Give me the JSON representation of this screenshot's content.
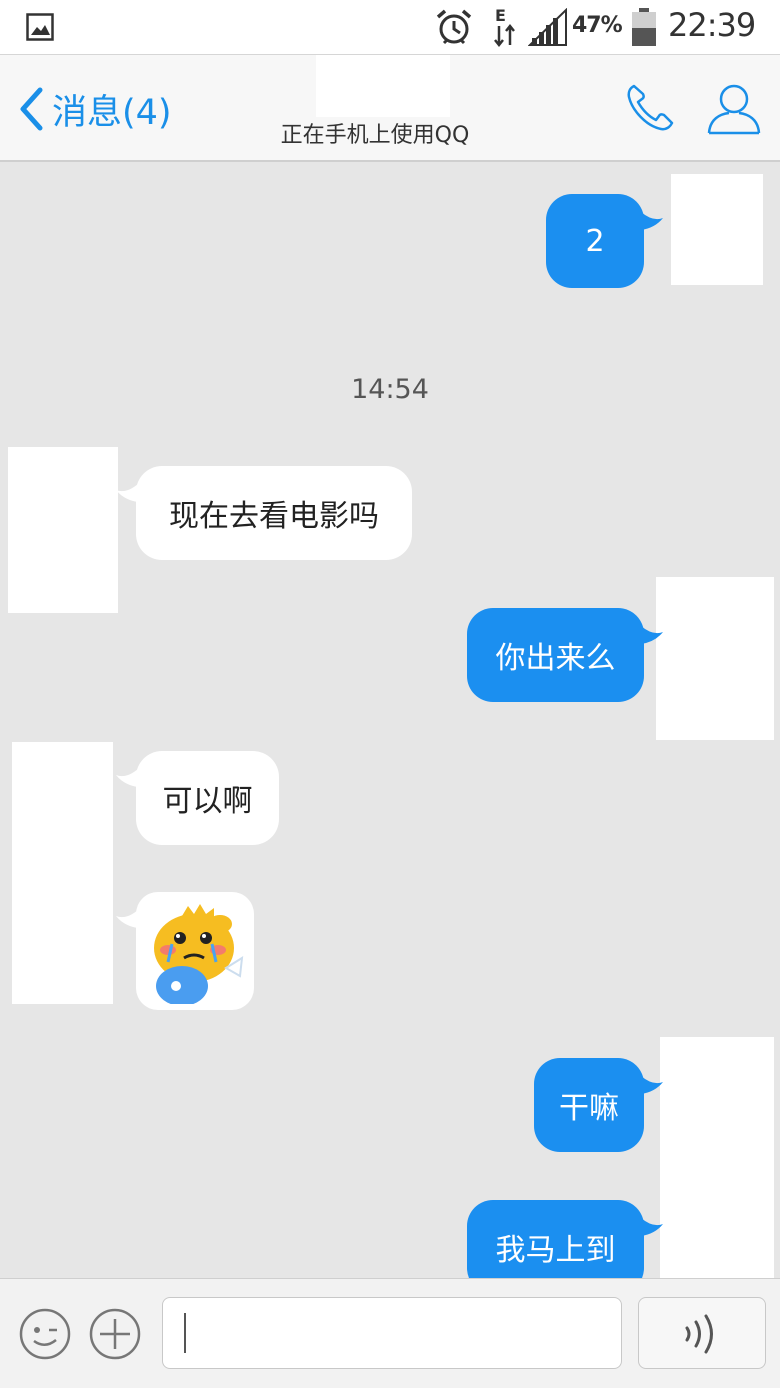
{
  "status_bar": {
    "battery_percent": "47%",
    "time": "22:39",
    "network_type": "E"
  },
  "header": {
    "back_label": "消息(4)",
    "subtitle": "正在手机上使用QQ"
  },
  "messages": [
    {
      "direction": "outgoing",
      "type": "text",
      "text": "2"
    },
    {
      "type": "timestamp",
      "text": "14:54"
    },
    {
      "direction": "incoming",
      "type": "text",
      "text": "现在去看电影吗"
    },
    {
      "direction": "outgoing",
      "type": "text",
      "text": "你出来么"
    },
    {
      "direction": "incoming",
      "type": "text",
      "text": "可以啊"
    },
    {
      "direction": "incoming",
      "type": "sticker",
      "sticker": "crying yellow dinosaur sticker"
    },
    {
      "direction": "outgoing",
      "type": "text",
      "text": "干嘛"
    },
    {
      "direction": "outgoing",
      "type": "text",
      "text": "我马上到"
    }
  ],
  "input_bar": {
    "text_value": ""
  },
  "colors": {
    "accent": "#1a8fe8",
    "outgoing_bubble": "#1b8ff0",
    "incoming_bubble": "#ffffff",
    "chat_background": "#e6e6e6"
  },
  "icons": [
    "image-icon",
    "alarm-clock-icon",
    "data-transfer-icon",
    "signal-icon",
    "battery-icon",
    "back-chevron-icon",
    "phone-icon",
    "profile-icon",
    "emoji-icon",
    "plus-icon",
    "voice-icon"
  ]
}
